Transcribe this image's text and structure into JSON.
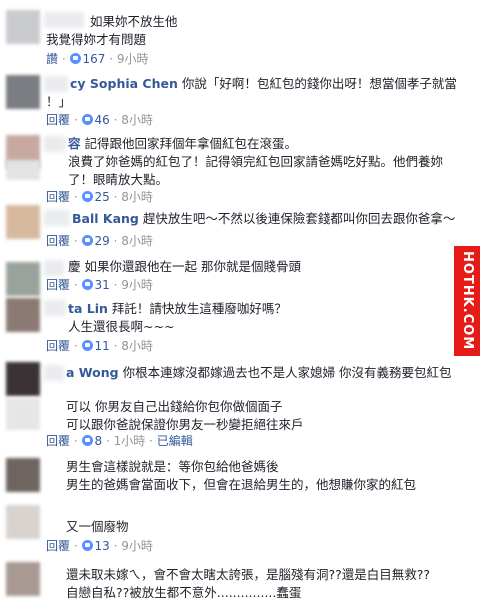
{
  "comments": [
    {
      "name": "",
      "lines": [
        "如果妳不放生他",
        "我覺得妳才有問題"
      ],
      "likes": "167",
      "time": "9小時",
      "reply": "",
      "edited": ""
    },
    {
      "name": "cy Sophia Chen",
      "lines": [
        "你說「好啊！包紅包的錢你出呀！想當個孝子就當",
        "！」"
      ],
      "likes": "46",
      "time": "8小時",
      "reply": "回覆",
      "edited": ""
    },
    {
      "name": "容",
      "lines": [
        "記得跟他回家拜個年拿個紅包在滾蛋。",
        "浪費了妳爸媽的紅包了！記得領完紅包回家請爸媽吃好點。他們養妳",
        "了！眼睛放大點。"
      ],
      "likes": "25",
      "time": "8小時",
      "reply": "回覆",
      "edited": ""
    },
    {
      "name": "Ball Kang",
      "lines": [
        "趕快放生吧～不然以後連保險套錢都叫你回去跟你爸拿～"
      ],
      "likes": "29",
      "time": "8小時",
      "reply": "回覆",
      "edited": ""
    },
    {
      "name": "",
      "lines": [
        "慶 如果你還跟他在一起 那你就是個賤骨頭"
      ],
      "likes": "31",
      "time": "9小時",
      "reply": "回覆",
      "edited": ""
    },
    {
      "name": "ta Lin",
      "lines": [
        "拜託！請快放生這種廢咖好嗎？",
        "人生還很長啊~~~"
      ],
      "likes": "11",
      "time": "8小時",
      "reply": "回覆",
      "edited": ""
    },
    {
      "name": "a Wong",
      "lines": [
        "你根本連嫁沒都嫁過去也不是人家媳婦 你沒有義務要包紅包",
        "可以 你男友自己出錢給你包你做個面子",
        "可以跟你爸說保證你男友一秒變拒絕往來戶"
      ],
      "likes": "8",
      "time": "1小時",
      "reply": "回覆",
      "edited": "已編輯"
    },
    {
      "name": "",
      "lines": [
        "男生會這樣說就是：等你包給他爸媽後",
        "男生的爸媽會當面收下，但會在退給男生的，他想賺你家的紅包"
      ],
      "likes": "",
      "time": "",
      "reply": "",
      "edited": ""
    },
    {
      "name": "",
      "lines": [
        "又一個廢物"
      ],
      "likes": "13",
      "time": "9小時",
      "reply": "回覆",
      "edited": ""
    },
    {
      "name": "",
      "lines": [
        "還未取未嫁ㄟ，會不會太瞎太誇張，是腦殘有洞??還是白目無救??",
        "自戀自私??被放生都不意外...............蠢蛋"
      ],
      "likes": "",
      "time": "",
      "reply": "",
      "edited": ""
    }
  ],
  "watermark": "HOTHK.COM"
}
